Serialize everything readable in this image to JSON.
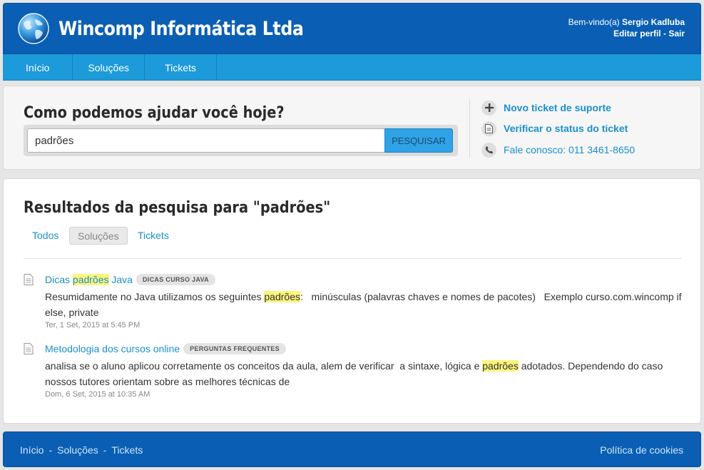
{
  "header": {
    "brand": "Wincomp Informática Ltda",
    "welcome_prefix": "Bem-vindo(a)",
    "user_name": "Sergio Kadluba",
    "edit_profile": "Editar perfil",
    "separator": " - ",
    "logout": "Sair"
  },
  "nav": {
    "items": [
      {
        "label": "Início"
      },
      {
        "label": "Soluções"
      },
      {
        "label": "Tickets"
      }
    ]
  },
  "search": {
    "heading": "Como podemos ajudar você hoje?",
    "value": "padrões",
    "button": "PESQUISAR"
  },
  "sidebar": {
    "new_ticket": "Novo ticket de suporte",
    "check_status": "Verificar o status do ticket",
    "contact": "Fale conosco: 011 3461-8650"
  },
  "results": {
    "heading": "Resultados da pesquisa para \"padrões\"",
    "filters": [
      "Todos",
      "Soluções",
      "Tickets"
    ],
    "active_filter": "Soluções",
    "items": [
      {
        "title_before": "Dicas ",
        "title_hl": "padrões",
        "title_after": " Java",
        "badge": "DICAS CURSO JAVA",
        "snippet_before": "Resumidamente no Java utilizamos os seguintes ",
        "snippet_hl": "padrões",
        "snippet_after": ":   minúsculas (palavras chaves e nomes de pacotes)   Exemplo curso.com.wincomp if else, private",
        "date": "Ter, 1 Set, 2015 at 5:45 PM"
      },
      {
        "title": "Metodologia dos cursos online",
        "badge": "PERGUNTAS FREQUENTES",
        "snippet_before": "analisa se o aluno aplicou corretamente os conceitos da aula, alem de verificar  a sintaxe, lógica e ",
        "snippet_hl": "padrões",
        "snippet_after": " adotados. Dependendo do caso nossos tutores orientam sobre as melhores técnicas de",
        "date": "Dom, 6 Set, 2015 at 10:35 AM"
      }
    ]
  },
  "footer": {
    "links": [
      "Início",
      "Soluções",
      "Tickets"
    ],
    "separator": "-",
    "cookies": "Política de cookies"
  },
  "colors": {
    "header_blue": "#0a5fb4",
    "nav_blue": "#1c9ad9",
    "link_blue": "#1a8fd0",
    "highlight": "#fbf57d"
  }
}
